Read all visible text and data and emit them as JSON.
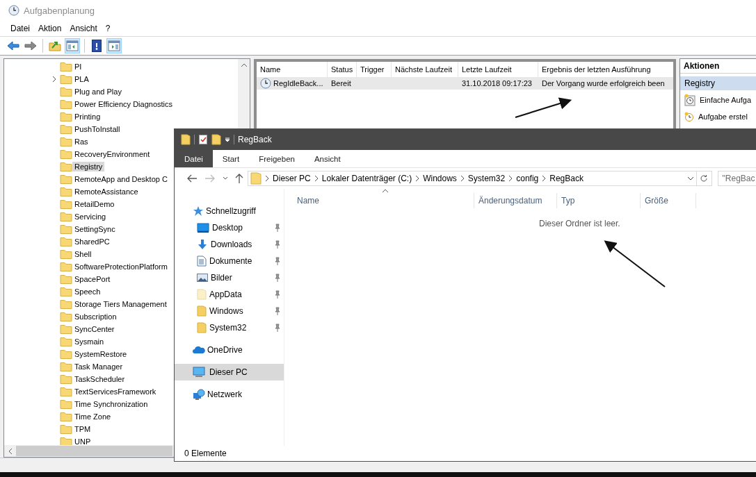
{
  "window": {
    "title": "Aufgabenplanung"
  },
  "menu": [
    {
      "label": "Datei"
    },
    {
      "label": "Aktion"
    },
    {
      "label": "Ansicht"
    },
    {
      "label": "?"
    }
  ],
  "toolbar": [
    [
      {
        "kind": "back",
        "pressed": false
      },
      {
        "kind": "forward",
        "pressed": false
      }
    ],
    [
      {
        "kind": "up-folder",
        "pressed": false
      },
      {
        "kind": "show-tree",
        "pressed": true
      }
    ],
    [
      {
        "kind": "help",
        "pressed": false
      },
      {
        "kind": "show-actions",
        "pressed": true
      }
    ]
  ],
  "tree": {
    "items": [
      {
        "label": "PI",
        "selected": false,
        "has_children": false
      },
      {
        "label": "PLA",
        "selected": false,
        "has_children": true
      },
      {
        "label": "Plug and Play",
        "selected": false,
        "has_children": false
      },
      {
        "label": "Power Efficiency Diagnostics",
        "selected": false,
        "has_children": false
      },
      {
        "label": "Printing",
        "selected": false,
        "has_children": false
      },
      {
        "label": "PushToInstall",
        "selected": false,
        "has_children": false
      },
      {
        "label": "Ras",
        "selected": false,
        "has_children": false
      },
      {
        "label": "RecoveryEnvironment",
        "selected": false,
        "has_children": false
      },
      {
        "label": "Registry",
        "selected": true,
        "has_children": false
      },
      {
        "label": "RemoteApp and Desktop C",
        "selected": false,
        "has_children": false
      },
      {
        "label": "RemoteAssistance",
        "selected": false,
        "has_children": false
      },
      {
        "label": "RetailDemo",
        "selected": false,
        "has_children": false
      },
      {
        "label": "Servicing",
        "selected": false,
        "has_children": false
      },
      {
        "label": "SettingSync",
        "selected": false,
        "has_children": false
      },
      {
        "label": "SharedPC",
        "selected": false,
        "has_children": false
      },
      {
        "label": "Shell",
        "selected": false,
        "has_children": false
      },
      {
        "label": "SoftwareProtectionPlatform",
        "selected": false,
        "has_children": false
      },
      {
        "label": "SpacePort",
        "selected": false,
        "has_children": false
      },
      {
        "label": "Speech",
        "selected": false,
        "has_children": false
      },
      {
        "label": "Storage Tiers Management",
        "selected": false,
        "has_children": false
      },
      {
        "label": "Subscription",
        "selected": false,
        "has_children": false
      },
      {
        "label": "SyncCenter",
        "selected": false,
        "has_children": false
      },
      {
        "label": "Sysmain",
        "selected": false,
        "has_children": false
      },
      {
        "label": "SystemRestore",
        "selected": false,
        "has_children": false
      },
      {
        "label": "Task Manager",
        "selected": false,
        "has_children": false
      },
      {
        "label": "TaskScheduler",
        "selected": false,
        "has_children": false
      },
      {
        "label": "TextServicesFramework",
        "selected": false,
        "has_children": false
      },
      {
        "label": "Time Synchronization",
        "selected": false,
        "has_children": false
      },
      {
        "label": "Time Zone",
        "selected": false,
        "has_children": false
      },
      {
        "label": "TPM",
        "selected": false,
        "has_children": false
      },
      {
        "label": "UNP",
        "selected": false,
        "has_children": false
      }
    ]
  },
  "tasks": {
    "columns": [
      {
        "label": "Name"
      },
      {
        "label": "Status"
      },
      {
        "label": "Trigger"
      },
      {
        "label": "Nächste Laufzeit"
      },
      {
        "label": "Letzte Laufzeit"
      },
      {
        "label": "Ergebnis der letzten Ausführung"
      }
    ],
    "rows": [
      {
        "name": "RegIdleBack...",
        "status": "Bereit",
        "last_run": "31.10.2018 09:17:23",
        "result": "Der Vorgang wurde erfolgreich been",
        "selected": true
      }
    ]
  },
  "actions": {
    "title": "Aktionen",
    "section": {
      "label": "Registry",
      "selected": true
    },
    "items": [
      {
        "label": "Einfache Aufga",
        "kind": "basic-task"
      },
      {
        "label": "Aufgabe erstel",
        "kind": "create-task"
      }
    ]
  },
  "explorer": {
    "title": "RegBack",
    "ribbon_tabs": [
      {
        "label": "Datei",
        "selected": true
      },
      {
        "label": "Start",
        "selected": false
      },
      {
        "label": "Freigeben",
        "selected": false
      },
      {
        "label": "Ansicht",
        "selected": false
      }
    ],
    "path": [
      "Dieser PC",
      "Lokaler Datenträger (C:)",
      "Windows",
      "System32",
      "config",
      "RegBack"
    ],
    "search": {
      "placeholder": "\"RegBac"
    },
    "navigation": [
      {
        "label": "Schnellzugriff",
        "kind": "star",
        "selected": false,
        "children": [
          {
            "label": "Desktop",
            "kind": "desktop",
            "pinned": true
          },
          {
            "label": "Downloads",
            "kind": "download",
            "pinned": true
          },
          {
            "label": "Dokumente",
            "kind": "document",
            "pinned": true
          },
          {
            "label": "Bilder",
            "kind": "pictures",
            "pinned": true
          },
          {
            "label": "AppData",
            "kind": "pale-folder",
            "pinned": true
          },
          {
            "label": "Windows",
            "kind": "folder",
            "pinned": true
          },
          {
            "label": "System32",
            "kind": "folder",
            "pinned": true
          }
        ]
      },
      {
        "label": "OneDrive",
        "kind": "cloud",
        "selected": false
      },
      {
        "label": "Dieser PC",
        "kind": "computer",
        "selected": true
      },
      {
        "label": "Netzwerk",
        "kind": "network",
        "selected": false
      }
    ],
    "columns": [
      {
        "label": "Name",
        "sorted": true
      },
      {
        "label": "Änderungsdatum",
        "sorted": false
      },
      {
        "label": "Typ",
        "sorted": false
      },
      {
        "label": "Größe",
        "sorted": false
      }
    ],
    "empty_message": "Dieser Ordner ist leer.",
    "status_bar": "0 Elemente"
  }
}
